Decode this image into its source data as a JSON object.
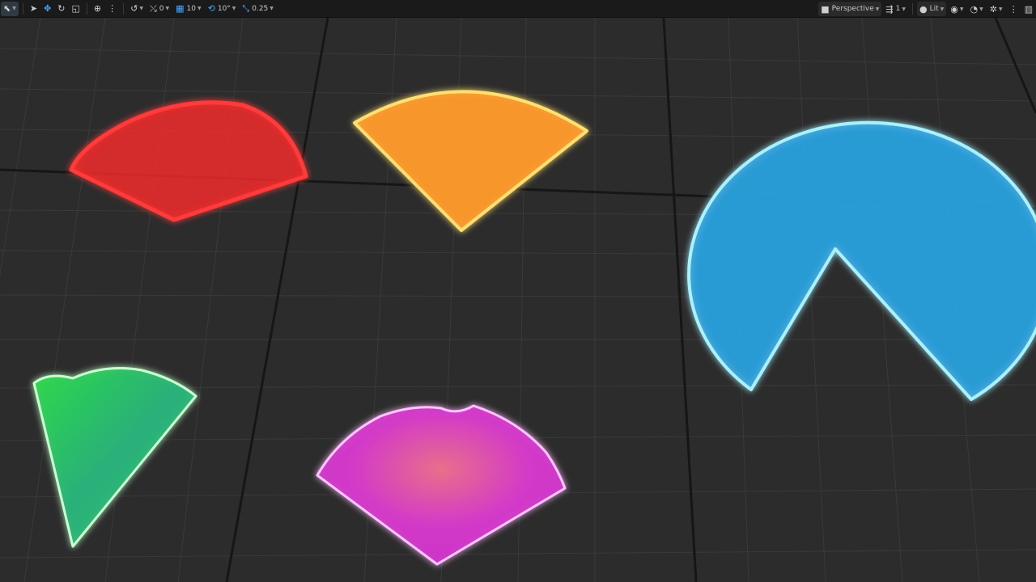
{
  "toolbar": {
    "left": {
      "translate_snap_value": "0",
      "grid_snap_value": "10",
      "rotation_snap_value": "10°",
      "scale_snap_value": "0.25"
    },
    "right": {
      "view_mode_label": "Perspective",
      "camera_speed_value": "1",
      "lighting_mode_label": "Lit"
    }
  },
  "scene": {
    "shapes": [
      {
        "name": "red-sector",
        "color": "#ff2a2a"
      },
      {
        "name": "orange-sector",
        "color": "#ff9a2a"
      },
      {
        "name": "blue-sector",
        "color": "#29a3e0"
      },
      {
        "name": "green-sector",
        "color": "#3fe04a"
      },
      {
        "name": "magenta-sector",
        "color": "#e23ad0"
      }
    ],
    "floor_color": "#2c2c2c",
    "grid_color": "#3c3c3c"
  }
}
